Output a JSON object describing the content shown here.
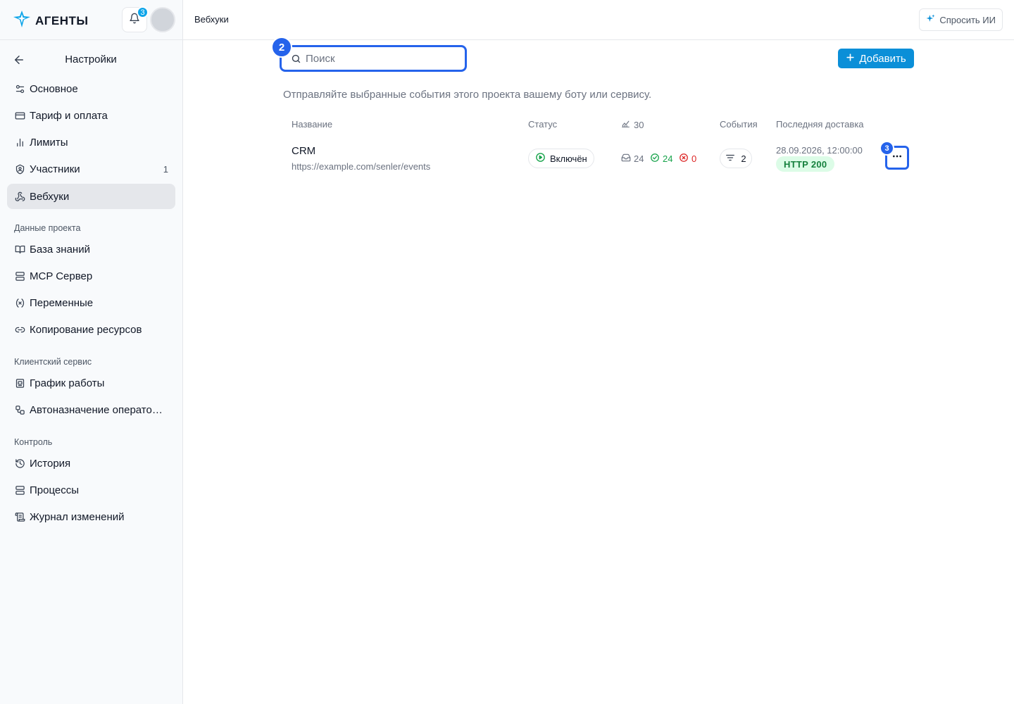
{
  "app": {
    "logo_text": "АГЕНТЫ",
    "notification_count": "3"
  },
  "sidebar": {
    "title": "Настройки",
    "items": [
      {
        "label": "Основное",
        "icon": "sliders-icon"
      },
      {
        "label": "Тариф и оплата",
        "icon": "credit-card-icon"
      },
      {
        "label": "Лимиты",
        "icon": "bar-chart-icon"
      },
      {
        "label": "Участники",
        "icon": "users-icon",
        "count": "1"
      },
      {
        "label": "Вебхуки",
        "icon": "webhook-icon",
        "active": true
      }
    ],
    "sections": [
      {
        "label": "Данные проекта",
        "items": [
          {
            "label": "База знаний",
            "icon": "book-icon"
          },
          {
            "label": "MCP Сервер",
            "icon": "server-icon"
          },
          {
            "label": "Переменные",
            "icon": "variable-icon"
          },
          {
            "label": "Копирование ресурсов",
            "icon": "link-icon"
          }
        ]
      },
      {
        "label": "Клиентский сервис",
        "items": [
          {
            "label": "График работы",
            "icon": "calendar-icon"
          },
          {
            "label": "Автоназначение операторов",
            "icon": "workflow-icon"
          }
        ]
      },
      {
        "label": "Контроль",
        "items": [
          {
            "label": "История",
            "icon": "history-icon"
          },
          {
            "label": "Процессы",
            "icon": "server-icon"
          },
          {
            "label": "Журнал изменений",
            "icon": "scroll-icon"
          }
        ]
      }
    ]
  },
  "topbar": {
    "breadcrumb": "Вебхуки",
    "ask_ai_label": "Спросить ИИ"
  },
  "toolbar": {
    "search_placeholder": "Поиск",
    "search_value": "",
    "add_label": "Добавить",
    "search_step": "2",
    "actions_step": "3"
  },
  "description": "Отправляйте выбранные события этого проекта вашему боту или сервису.",
  "table": {
    "headers": {
      "name": "Название",
      "status": "Статус",
      "activity": "30",
      "events": "События",
      "last_delivery": "Последняя доставка"
    },
    "rows": [
      {
        "name": "CRM",
        "url": "https://example.com/senler/events",
        "status": "Включён",
        "received": "24",
        "success": "24",
        "failed": "0",
        "events_count": "2",
        "last_delivery_time": "28.09.2026, 12:00:00",
        "http_status": "HTTP 200"
      }
    ]
  },
  "colors": {
    "accent": "#0b8fd8",
    "focus": "#2563eb",
    "success": "#16a34a",
    "danger": "#dc2626"
  }
}
